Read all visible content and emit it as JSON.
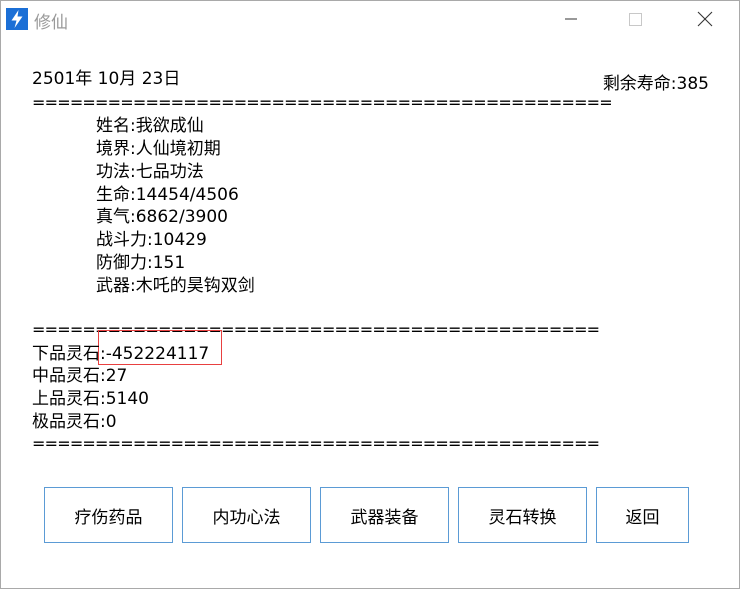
{
  "window": {
    "title": "修仙"
  },
  "header": {
    "date": "2501年  10月  23日",
    "lifespan": "剩余寿命:385"
  },
  "separators": {
    "top": "==============================================",
    "middle": "=============================================",
    "bottom": "============================================="
  },
  "profile": {
    "name": "姓名:我欲成仙",
    "realm": "境界:人仙境初期",
    "technique": "功法:七品功法",
    "health": "生命:14454/4506",
    "qi": "真气:6862/3900",
    "combat_power": "战斗力:10429",
    "defense": "防御力:151",
    "weapon": "武器:木吒的昊钩双剑"
  },
  "spirit_stones": {
    "low": "下品灵石:-452224117",
    "mid": "中品灵石:27",
    "high": "上品灵石:5140",
    "top": "极品灵石:0"
  },
  "buttons": {
    "heal_medicine": "疗伤药品",
    "inner_art": "内功心法",
    "weapon_equip": "武器装备",
    "stone_convert": "灵石转换",
    "back": "返回"
  },
  "colors": {
    "accent_border": "#5b9bd5",
    "highlight": "#e84040",
    "app_icon": "#1b6fd6"
  }
}
